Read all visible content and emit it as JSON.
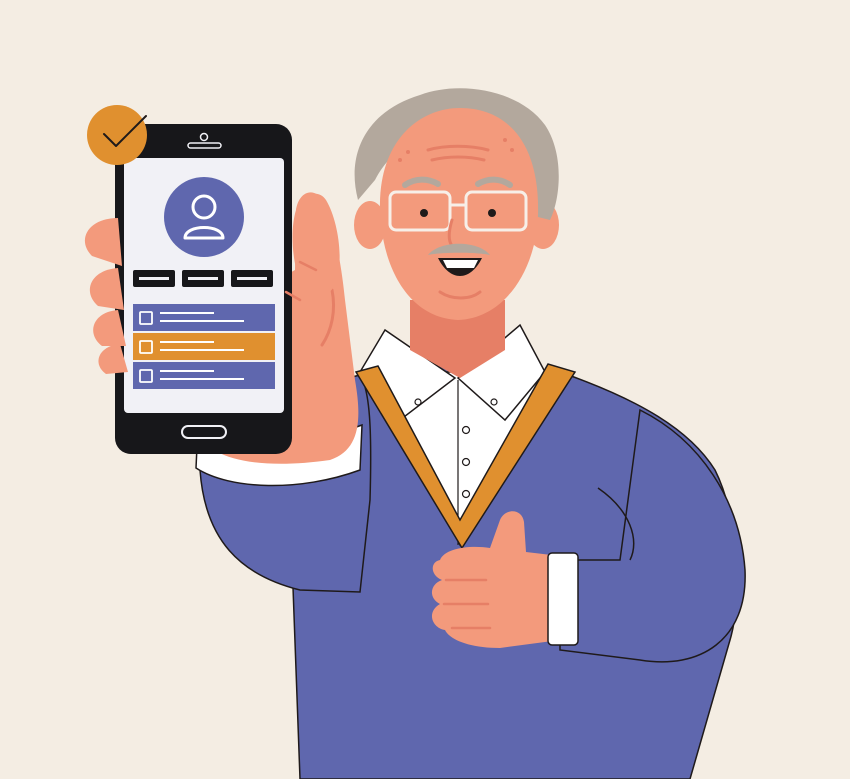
{
  "illustration": {
    "subject": "elderly-man-holding-smartphone-thumbs-up",
    "icons": [
      "check-badge-icon",
      "user-avatar-icon",
      "checkbox-icon"
    ],
    "colors": {
      "background": "#f4ede3",
      "skin": "#f39a7c",
      "skin_shadow": "#e67f66",
      "skin_light": "#f7ad92",
      "hair": "#b3a89d",
      "sweater": "#5f67ae",
      "stripe": "#e0902f",
      "shirt": "#ffffff",
      "phone_body": "#17171a",
      "screen": "#f1f1f6",
      "avatar_circle": "#5f67ae",
      "selected_row": "#e0902f",
      "outline": "#1f1a1a"
    }
  }
}
